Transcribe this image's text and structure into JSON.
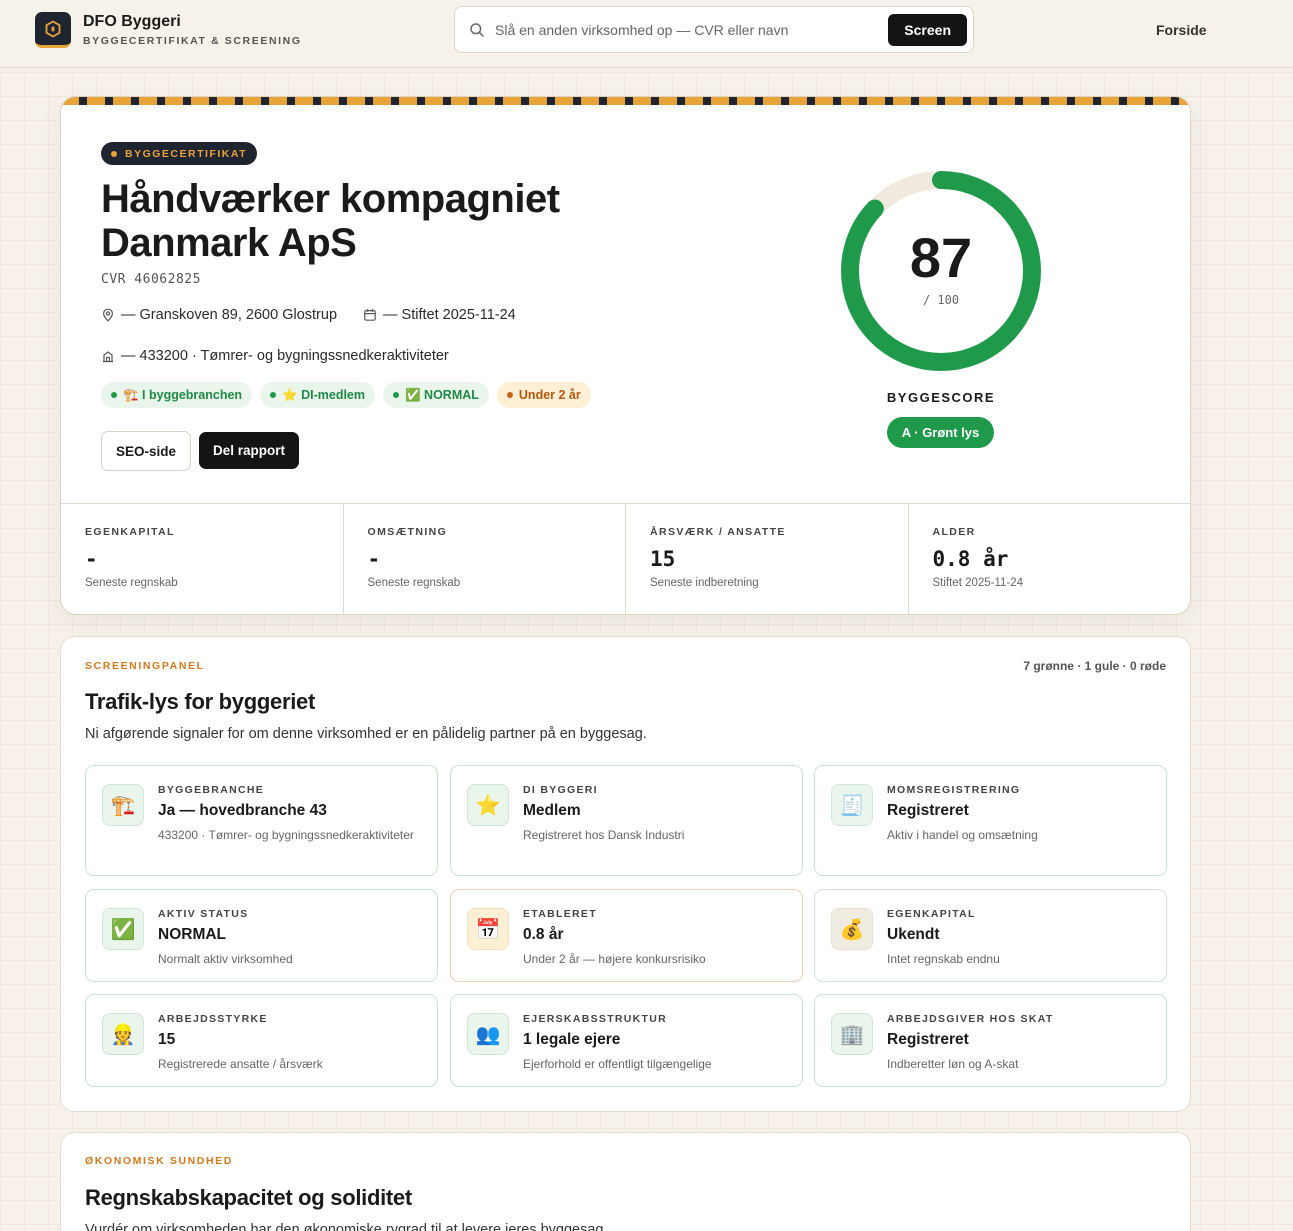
{
  "header": {
    "brand_title": "DFO Byggeri",
    "brand_subtitle": "BYGGECERTIFIKAT & SCREENING",
    "search_placeholder": "Slå en anden virksomhed op — CVR eller navn",
    "search_button": "Screen",
    "nav_home": "Forside"
  },
  "hero": {
    "badge": "BYGGECERTIFIKAT",
    "company_name": "Håndværker kompagniet Danmark ApS",
    "cvr": "CVR 46062825",
    "address": "— Granskoven 89, 2600 Glostrup",
    "founded": "— Stiftet 2025-11-24",
    "industry": "— 433200 · Tømrer- og bygningssnedkeraktiviteter",
    "chips": [
      {
        "label": "🏗️ I byggebranchen",
        "tone": "green"
      },
      {
        "label": "⭐ DI-medlem",
        "tone": "green"
      },
      {
        "label": "✅ NORMAL",
        "tone": "green"
      },
      {
        "label": "Under 2 år",
        "tone": "amber"
      }
    ],
    "btn_seo": "SEO-side",
    "btn_share": "Del rapport",
    "score": 87,
    "score_text": "87",
    "score_max": "/ 100",
    "score_label": "BYGGESCORE",
    "score_grade": "A · Grønt lys",
    "colors": {
      "accent": "#e8a33a",
      "dark": "#1f2530",
      "green": "#1f9a4a",
      "track": "#efe9de"
    }
  },
  "stats": [
    {
      "label": "EGENKAPITAL",
      "value": "-",
      "note": "Seneste regnskab"
    },
    {
      "label": "OMSÆTNING",
      "value": "-",
      "note": "Seneste regnskab"
    },
    {
      "label": "ÅRSVÆRK / ANSATTE",
      "value": "15",
      "note": "Seneste indberetning"
    },
    {
      "label": "ALDER",
      "value": "0.8 år",
      "note": "Stiftet 2025-11-24"
    }
  ],
  "screening": {
    "eyebrow": "SCREENINGPANEL",
    "summary": "7 grønne · 1 gule · 0 røde",
    "title": "Trafik-lys for byggeriet",
    "description": "Ni afgørende signaler for om denne virksomhed er en pålidelig partner på en byggesag.",
    "cards": [
      {
        "icon": "🏗️",
        "icon_name": "crane-icon",
        "label": "BYGGEBRANCHE",
        "value": "Ja — hovedbranche 43",
        "note": "433200 · Tømrer- og bygningssnedkeraktiviteter",
        "tone": "green"
      },
      {
        "icon": "⭐",
        "icon_name": "star-icon",
        "label": "DI BYGGERI",
        "value": "Medlem",
        "note": "Registreret hos Dansk Industri",
        "tone": "green"
      },
      {
        "icon": "🧾",
        "icon_name": "receipt-icon",
        "label": "MOMSREGISTRERING",
        "value": "Registreret",
        "note": "Aktiv i handel og omsætning",
        "tone": "green"
      },
      {
        "icon": "✅",
        "icon_name": "check-icon",
        "label": "AKTIV STATUS",
        "value": "NORMAL",
        "note": "Normalt aktiv virksomhed",
        "tone": "green"
      },
      {
        "icon": "📅",
        "icon_name": "calendar-icon",
        "label": "ETABLERET",
        "value": "0.8 år",
        "note": "Under 2 år — højere konkursrisiko",
        "tone": "amber"
      },
      {
        "icon": "💰",
        "icon_name": "money-bag-icon",
        "label": "EGENKAPITAL",
        "value": "Ukendt",
        "note": "Intet regnskab endnu",
        "tone": "neutral"
      },
      {
        "icon": "👷",
        "icon_name": "worker-icon",
        "label": "ARBEJDSSTYRKE",
        "value": "15",
        "note": "Registrerede ansatte / årsværk",
        "tone": "green"
      },
      {
        "icon": "👥",
        "icon_name": "people-icon",
        "label": "EJERSKABSSTRUKTUR",
        "value": "1 legale ejere",
        "note": "Ejerforhold er offentligt tilgængelige",
        "tone": "green"
      },
      {
        "icon": "🏢",
        "icon_name": "office-building-icon",
        "label": "ARBEJDSGIVER HOS SKAT",
        "value": "Registreret",
        "note": "Indberetter løn og A-skat",
        "tone": "green"
      }
    ]
  },
  "economy": {
    "eyebrow": "ØKONOMISK SUNDHED",
    "title": "Regnskabskapacitet og soliditet",
    "description": "Vurdér om virksomheden har den økonomiske rygrad til at levere jeres byggesag."
  }
}
